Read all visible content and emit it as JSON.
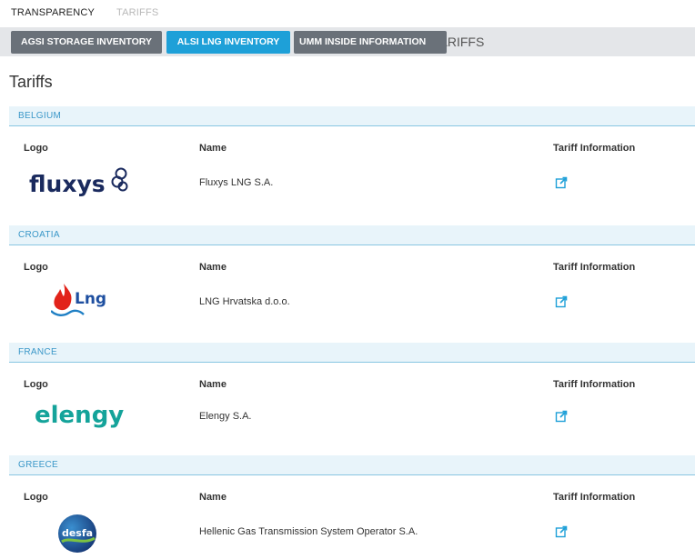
{
  "topnav": {
    "transparency": "TRANSPARENCY",
    "tariffs": "TARIFFS"
  },
  "subnav": {
    "agsi": "AGSI STORAGE INVENTORY",
    "alsi": "ALSI LNG INVENTORY",
    "umm": "UMM INSIDE INFORMATION",
    "tariffs": "TARIFFS"
  },
  "page_title": "Tariffs",
  "columns": {
    "logo": "Logo",
    "name": "Name",
    "tariff": "Tariff Information"
  },
  "colors": {
    "accent": "#1ea0d8",
    "section_bg": "#e8f4fa",
    "section_text": "#3a97c8"
  },
  "sections": [
    {
      "country": "BELGIUM",
      "operator": "Fluxys LNG S.A.",
      "logo_text": "fluxys"
    },
    {
      "country": "CROATIA",
      "operator": "LNG Hrvatska d.o.o.",
      "logo_text": "Lng"
    },
    {
      "country": "FRANCE",
      "operator": "Elengy S.A.",
      "logo_text": "elengy"
    },
    {
      "country": "GREECE",
      "operator": "Hellenic Gas Transmission System Operator S.A.",
      "logo_text": "desfa"
    }
  ]
}
